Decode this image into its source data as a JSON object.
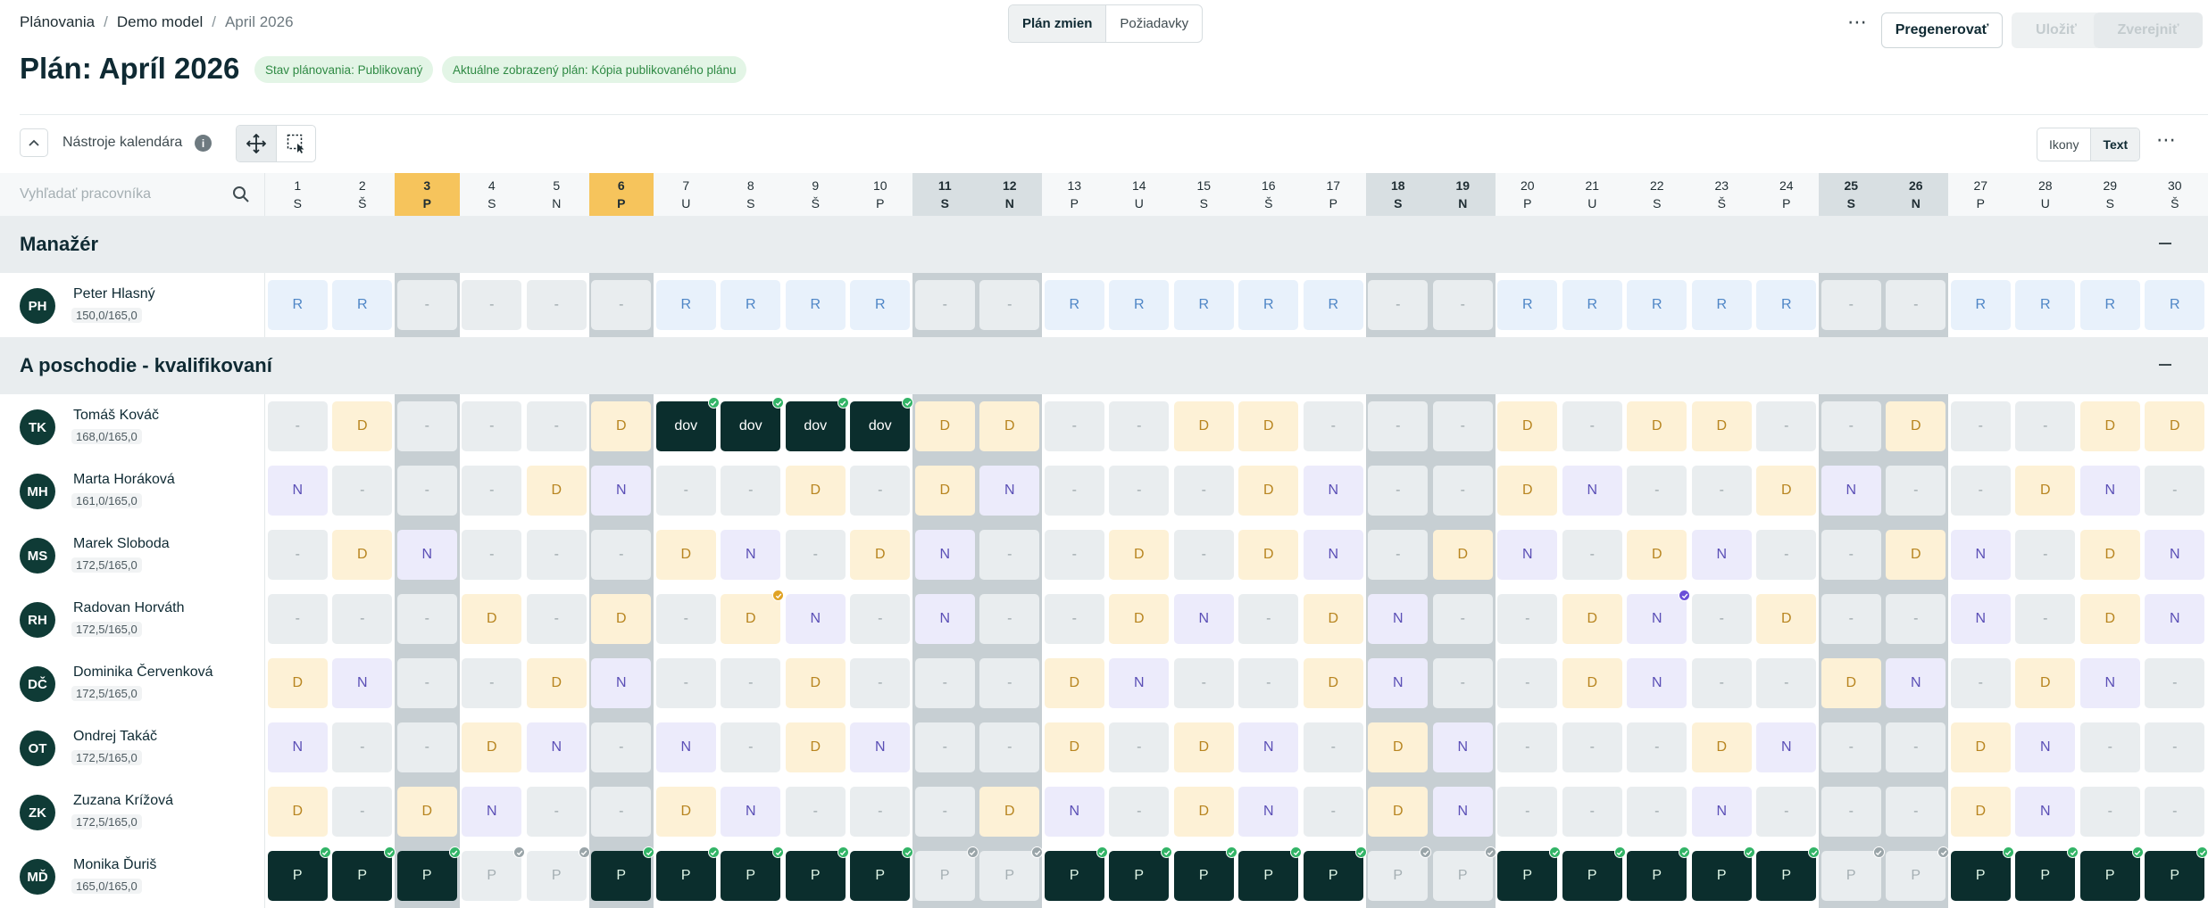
{
  "breadcrumb": {
    "items": [
      "Plánovania",
      "Demo model",
      "April 2026"
    ]
  },
  "title": "Plán: Apríl 2026",
  "badges": {
    "status": "Stav plánovania: Publikovaný",
    "current": "Aktuálne zobrazený plán: Kópia publikovaného plánu"
  },
  "view_toggle": {
    "plan": "Plán zmien",
    "requests": "Požiadavky"
  },
  "actions": {
    "more": "⋯",
    "regenerate": "Pregenerovať",
    "save": "Uložiť",
    "publish": "Zverejniť"
  },
  "tools": {
    "collapse": "⌃",
    "label": "Nástroje kalendára",
    "info": "i",
    "more": "⋯",
    "icons_label": "Ikony",
    "text_label": "Text"
  },
  "search": {
    "placeholder": "Vyhľadať pracovníka"
  },
  "days": [
    {
      "num": "1",
      "dow": "S",
      "type": "normal"
    },
    {
      "num": "2",
      "dow": "Š",
      "type": "normal"
    },
    {
      "num": "3",
      "dow": "P",
      "type": "holiday"
    },
    {
      "num": "4",
      "dow": "S",
      "type": "normal"
    },
    {
      "num": "5",
      "dow": "N",
      "type": "normal"
    },
    {
      "num": "6",
      "dow": "P",
      "type": "holiday"
    },
    {
      "num": "7",
      "dow": "U",
      "type": "normal"
    },
    {
      "num": "8",
      "dow": "S",
      "type": "normal"
    },
    {
      "num": "9",
      "dow": "Š",
      "type": "normal"
    },
    {
      "num": "10",
      "dow": "P",
      "type": "normal"
    },
    {
      "num": "11",
      "dow": "S",
      "type": "weekend"
    },
    {
      "num": "12",
      "dow": "N",
      "type": "weekend"
    },
    {
      "num": "13",
      "dow": "P",
      "type": "normal"
    },
    {
      "num": "14",
      "dow": "U",
      "type": "normal"
    },
    {
      "num": "15",
      "dow": "S",
      "type": "normal"
    },
    {
      "num": "16",
      "dow": "Š",
      "type": "normal"
    },
    {
      "num": "17",
      "dow": "P",
      "type": "normal"
    },
    {
      "num": "18",
      "dow": "S",
      "type": "weekend"
    },
    {
      "num": "19",
      "dow": "N",
      "type": "weekend"
    },
    {
      "num": "20",
      "dow": "P",
      "type": "normal"
    },
    {
      "num": "21",
      "dow": "U",
      "type": "normal"
    },
    {
      "num": "22",
      "dow": "S",
      "type": "normal"
    },
    {
      "num": "23",
      "dow": "Š",
      "type": "normal"
    },
    {
      "num": "24",
      "dow": "P",
      "type": "normal"
    },
    {
      "num": "25",
      "dow": "S",
      "type": "weekend"
    },
    {
      "num": "26",
      "dow": "N",
      "type": "weekend"
    },
    {
      "num": "27",
      "dow": "P",
      "type": "normal"
    },
    {
      "num": "28",
      "dow": "U",
      "type": "normal"
    },
    {
      "num": "29",
      "dow": "S",
      "type": "normal"
    },
    {
      "num": "30",
      "dow": "Š",
      "type": "normal"
    }
  ],
  "groups": [
    {
      "name": "Manažér",
      "employees": [
        {
          "initials": "PH",
          "name": "Peter Hlasný",
          "hours": "150,0/165,0",
          "shifts": [
            "R",
            "R",
            "-",
            "-",
            "-",
            "-",
            "R",
            "R",
            "R",
            "R",
            "-",
            "-",
            "R",
            "R",
            "R",
            "R",
            "R",
            "-",
            "-",
            "R",
            "R",
            "R",
            "R",
            "R",
            "-",
            "-",
            "R",
            "R",
            "R",
            "R"
          ],
          "marks": {}
        }
      ]
    },
    {
      "name": "A poschodie - kvalifikovaní",
      "employees": [
        {
          "initials": "TK",
          "name": "Tomáš Kováč",
          "hours": "168,0/165,0",
          "shifts": [
            "-",
            "D",
            "-",
            "-",
            "-",
            "D",
            "dov",
            "dov",
            "dov",
            "dov",
            "D",
            "D",
            "-",
            "-",
            "D",
            "D",
            "-",
            "-",
            "-",
            "D",
            "-",
            "D",
            "D",
            "-",
            "-",
            "D",
            "-",
            "-",
            "D",
            "D"
          ],
          "marks": {
            "6": "green",
            "7": "green",
            "8": "green",
            "9": "green"
          }
        },
        {
          "initials": "MH",
          "name": "Marta Horáková",
          "hours": "161,0/165,0",
          "shifts": [
            "N",
            "-",
            "-",
            "-",
            "D",
            "N",
            "-",
            "-",
            "D",
            "-",
            "D",
            "N",
            "-",
            "-",
            "-",
            "D",
            "N",
            "-",
            "-",
            "D",
            "N",
            "-",
            "-",
            "D",
            "N",
            "-",
            "-",
            "D",
            "N",
            "-"
          ],
          "marks": {}
        },
        {
          "initials": "MS",
          "name": "Marek Sloboda",
          "hours": "172,5/165,0",
          "shifts": [
            "-",
            "D",
            "N",
            "-",
            "-",
            "-",
            "D",
            "N",
            "-",
            "D",
            "N",
            "-",
            "-",
            "D",
            "-",
            "D",
            "N",
            "-",
            "D",
            "N",
            "-",
            "D",
            "N",
            "-",
            "-",
            "D",
            "N",
            "-",
            "D",
            "N"
          ],
          "marks": {}
        },
        {
          "initials": "RH",
          "name": "Radovan Horváth",
          "hours": "172,5/165,0",
          "shifts": [
            "-",
            "-",
            "-",
            "D",
            "-",
            "D",
            "-",
            "D",
            "N",
            "-",
            "N",
            "-",
            "-",
            "D",
            "N",
            "-",
            "D",
            "N",
            "-",
            "-",
            "D",
            "N",
            "-",
            "D",
            "-",
            "-",
            "N",
            "-",
            "D",
            "N"
          ],
          "marks": {
            "7": "orange",
            "21": "purple"
          }
        },
        {
          "initials": "DČ",
          "name": "Dominika Červenková",
          "hours": "172,5/165,0",
          "shifts": [
            "D",
            "N",
            "-",
            "-",
            "D",
            "N",
            "-",
            "-",
            "D",
            "-",
            "-",
            "-",
            "D",
            "N",
            "-",
            "-",
            "D",
            "N",
            "-",
            "-",
            "D",
            "N",
            "-",
            "-",
            "D",
            "N",
            "-",
            "D",
            "N",
            "-"
          ],
          "marks": {}
        },
        {
          "initials": "OT",
          "name": "Ondrej Takáč",
          "hours": "172,5/165,0",
          "shifts": [
            "N",
            "-",
            "-",
            "D",
            "N",
            "-",
            "N",
            "-",
            "D",
            "N",
            "-",
            "-",
            "D",
            "-",
            "D",
            "N",
            "-",
            "D",
            "N",
            "-",
            "-",
            "-",
            "D",
            "N",
            "-",
            "-",
            "D",
            "N",
            "-",
            "-"
          ],
          "marks": {}
        },
        {
          "initials": "ZK",
          "name": "Zuzana Krížová",
          "hours": "172,5/165,0",
          "shifts": [
            "D",
            "-",
            "D",
            "N",
            "-",
            "-",
            "D",
            "N",
            "-",
            "-",
            "-",
            "D",
            "N",
            "-",
            "D",
            "N",
            "-",
            "D",
            "N",
            "-",
            "-",
            "-",
            "N",
            "-",
            "-",
            "-",
            "D",
            "N",
            "-",
            "-"
          ],
          "marks": {}
        },
        {
          "initials": "MĎ",
          "name": "Monika Ďuriš",
          "hours": "165,0/165,0",
          "shifts": [
            "P",
            "P",
            "P",
            "P",
            "P",
            "P",
            "P",
            "P",
            "P",
            "P",
            "P",
            "P",
            "P",
            "P",
            "P",
            "P",
            "P",
            "P",
            "P",
            "P",
            "P",
            "P",
            "P",
            "P",
            "P",
            "P",
            "P",
            "P",
            "P",
            "P"
          ],
          "light": [
            3,
            4,
            10,
            11,
            17,
            18,
            24,
            25
          ],
          "marks": {
            "0": "green",
            "1": "green",
            "2": "green",
            "3": "grey",
            "4": "grey",
            "5": "green",
            "6": "green",
            "7": "green",
            "8": "green",
            "9": "green",
            "10": "grey",
            "11": "grey",
            "12": "green",
            "13": "green",
            "14": "green",
            "15": "green",
            "16": "green",
            "17": "grey",
            "18": "grey",
            "19": "green",
            "20": "green",
            "21": "green",
            "22": "green",
            "23": "green",
            "24": "grey",
            "25": "grey",
            "26": "green",
            "27": "green",
            "28": "green",
            "29": "green"
          }
        }
      ]
    }
  ]
}
